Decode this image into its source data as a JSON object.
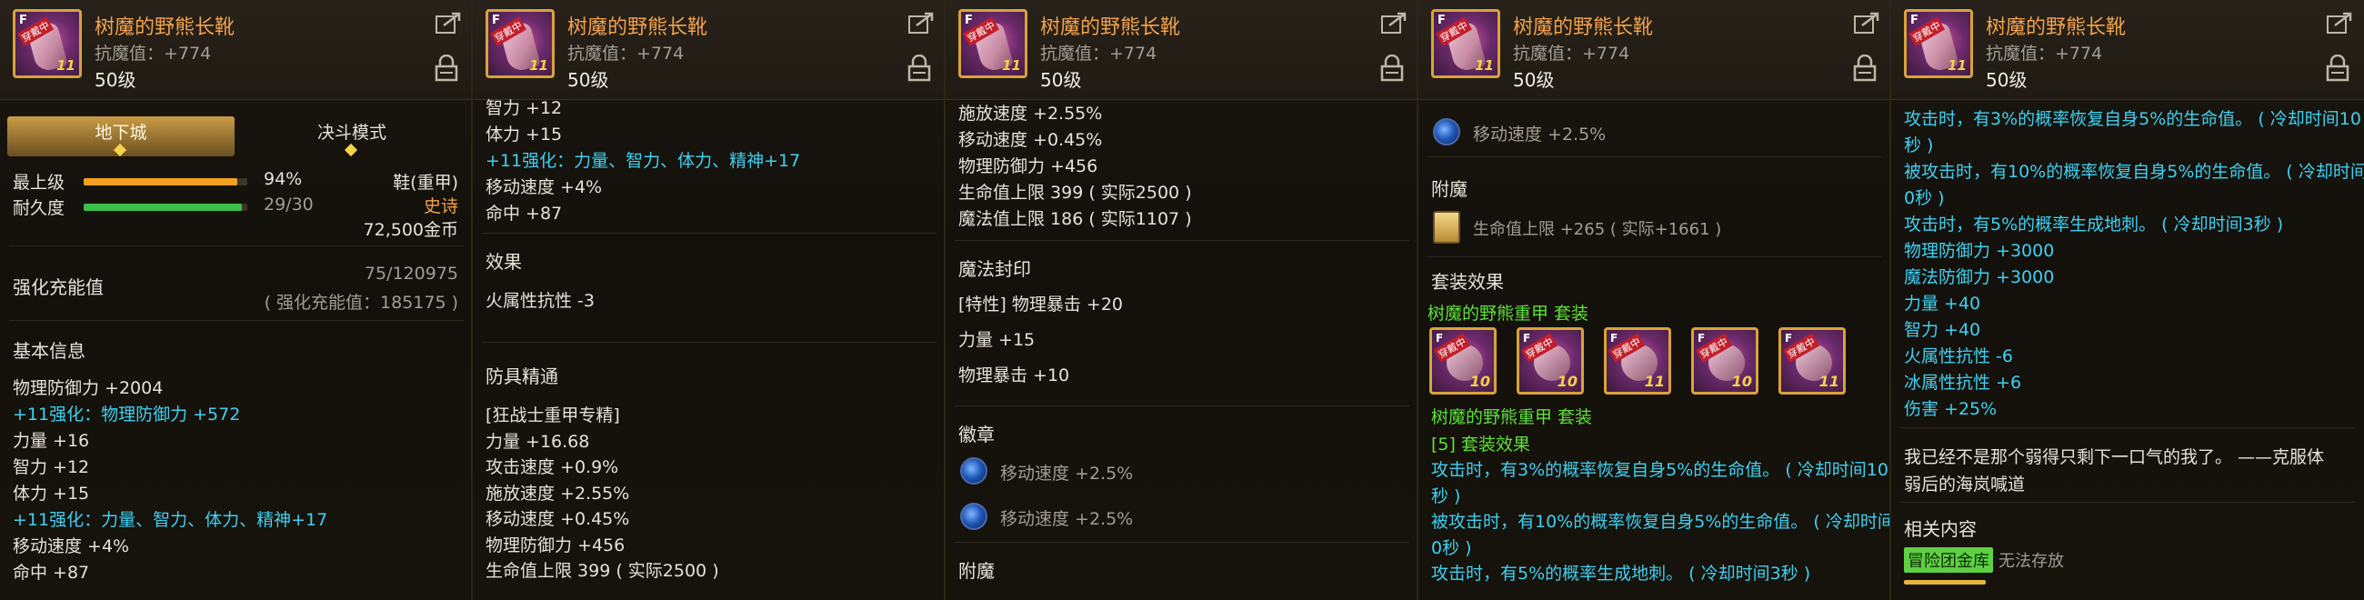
{
  "item": {
    "name": "树魔的野熊长靴",
    "resist": "抗魔值：+774",
    "level": "50级",
    "icon_rank": "F",
    "icon_badge": "穿戴中",
    "icon_plus": "11"
  },
  "panel1": {
    "tabs": [
      {
        "label": "地下城"
      },
      {
        "label": "决斗模式"
      }
    ],
    "max_level_label": "最上级",
    "max_level_value": "94%",
    "max_level_fraction": 0.94,
    "durability_label": "耐久度",
    "durability_value": "29/30",
    "durability_fraction": 0.967,
    "slot_type": "鞋(重甲)",
    "rarity": "史诗",
    "price": "72,500金币",
    "charge_label": "强化充能值",
    "charge_value": "75/120975",
    "charge_sub": "( 强化充能值：185175 )",
    "basic_info_title": "基本信息",
    "lines": [
      {
        "text": "物理防御力 +2004",
        "color": "white"
      },
      {
        "text": "+11强化：物理防御力 +572",
        "color": "blue"
      },
      {
        "text": "力量 +16",
        "color": "white"
      },
      {
        "text": "智力 +12",
        "color": "white"
      },
      {
        "text": "体力 +15",
        "color": "white"
      },
      {
        "text": "+11强化：力量、智力、体力、精神+17",
        "color": "blue"
      },
      {
        "text": "移动速度 +4%",
        "color": "white"
      },
      {
        "text": "命中 +87",
        "color": "white"
      }
    ]
  },
  "panel2": {
    "top_lines": [
      {
        "text": "智力 +12",
        "color": "white"
      },
      {
        "text": "体力 +15",
        "color": "white"
      },
      {
        "text": "+11强化：力量、智力、体力、精神+17",
        "color": "blue"
      },
      {
        "text": "移动速度 +4%",
        "color": "white"
      },
      {
        "text": "命中 +87",
        "color": "white"
      }
    ],
    "effect_title": "效果",
    "effect_line": "火属性抗性 -3",
    "mastery_title": "防具精通",
    "mastery_lines": [
      {
        "text": "[狂战士重甲专精]",
        "color": "white"
      },
      {
        "text": "力量 +16.68",
        "color": "white"
      },
      {
        "text": "攻击速度 +0.9%",
        "color": "white"
      },
      {
        "text": "施放速度 +2.55%",
        "color": "white"
      },
      {
        "text": "移动速度 +0.45%",
        "color": "white"
      },
      {
        "text": "物理防御力 +456",
        "color": "white"
      },
      {
        "text": "生命值上限 399 ( 实际2500 )",
        "color": "white"
      }
    ]
  },
  "panel3": {
    "top_lines": [
      {
        "text": "施放速度 +2.55%",
        "color": "white"
      },
      {
        "text": "移动速度 +0.45%",
        "color": "white"
      },
      {
        "text": "物理防御力 +456",
        "color": "white"
      },
      {
        "text": "生命值上限 399 ( 实际2500 )",
        "color": "white"
      },
      {
        "text": "魔法值上限 186 ( 实际1107 )",
        "color": "white"
      }
    ],
    "seal_title": "魔法封印",
    "seal_lines": [
      {
        "text": "[特性] 物理暴击 +20",
        "color": "white"
      },
      {
        "text": "力量 +15",
        "color": "white"
      },
      {
        "text": "物理暴击 +10",
        "color": "white"
      }
    ],
    "emblem_title": "徽章",
    "emblems": [
      {
        "text": "移动速度 +2.5%"
      },
      {
        "text": "移动速度 +2.5%"
      }
    ],
    "enchant_title": "附魔"
  },
  "panel4": {
    "emblem_line": "移动速度 +2.5%",
    "enchant_title": "附魔",
    "enchant_line": "生命值上限 +265 ( 实际+1661 )",
    "set_title": "套装效果",
    "set_name": "树魔的野熊重甲 套装",
    "set_icon_pluses": [
      "10",
      "10",
      "11",
      "10",
      "11"
    ],
    "set_name2": "树魔的野熊重甲 套装",
    "set_bonus_title": "[5] 套装效果",
    "set_bonus_lines": [
      {
        "text": "攻击时，有3%的概率恢复自身5%的生命值。 ( 冷却时间10",
        "color": "blue"
      },
      {
        "text": "秒 )",
        "color": "blue"
      },
      {
        "text": "被攻击时，有10%的概率恢复自身5%的生命值。 ( 冷却时间1",
        "color": "blue"
      },
      {
        "text": "0秒 )",
        "color": "blue"
      },
      {
        "text": "攻击时，有5%的概率生成地刺。 ( 冷却时间3秒 )",
        "color": "blue"
      }
    ]
  },
  "panel5": {
    "lines": [
      {
        "text": "攻击时，有3%的概率恢复自身5%的生命值。 ( 冷却时间10",
        "color": "blue"
      },
      {
        "text": "秒 )",
        "color": "blue"
      },
      {
        "text": "被攻击时，有10%的概率恢复自身5%的生命值。 ( 冷却时间1",
        "color": "blue"
      },
      {
        "text": "0秒 )",
        "color": "blue"
      },
      {
        "text": "攻击时，有5%的概率生成地刺。 ( 冷却时间3秒 )",
        "color": "blue"
      },
      {
        "text": "物理防御力 +3000",
        "color": "blue"
      },
      {
        "text": "魔法防御力 +3000",
        "color": "blue"
      },
      {
        "text": "力量 +40",
        "color": "blue"
      },
      {
        "text": "智力 +40",
        "color": "blue"
      },
      {
        "text": "火属性抗性 -6",
        "color": "blue"
      },
      {
        "text": "冰属性抗性 +6",
        "color": "blue"
      },
      {
        "text": "伤害 +25%",
        "color": "blue"
      }
    ],
    "flavor_1": "我已经不是那个弱得只剩下一口气的我了。 ——克服体",
    "flavor_2": "弱后的海岚喊道",
    "related_title": "相关内容",
    "vault_tag": "冒险团金库",
    "vault_note": "无法存放"
  },
  "colors": {
    "white": "#e6e2d8",
    "blue": "#3fd0f0",
    "green": "#5ee03a",
    "orange": "#f2a24b",
    "grey": "#a29d91",
    "bar_orange": "#f2a21e",
    "bar_green": "#3cc04a"
  },
  "icons": [
    "share-icon",
    "lock-icon",
    "rune-icon",
    "enchant-card-icon",
    "item-icon"
  ]
}
